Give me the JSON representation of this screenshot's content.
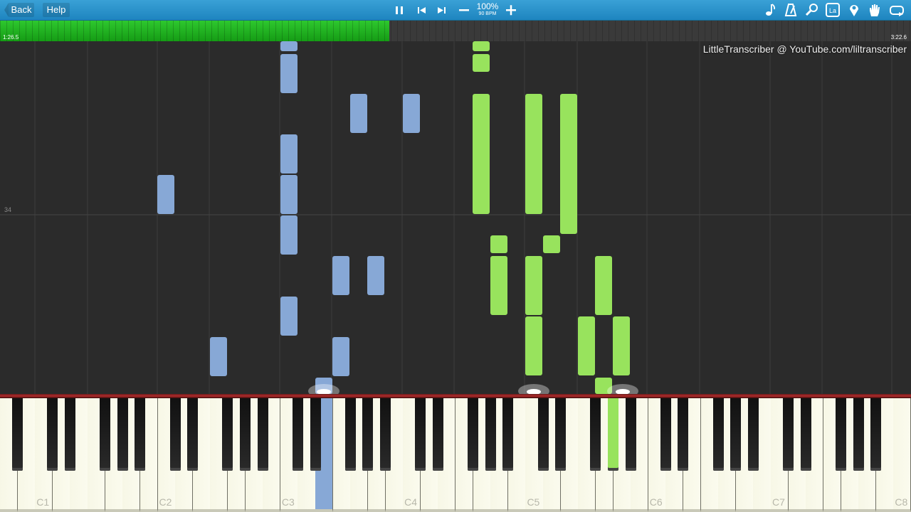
{
  "toolbar": {
    "back_label": "Back",
    "help_label": "Help",
    "tempo_percent": "100%",
    "tempo_bpm": "90 BPM",
    "icons": [
      "pause-icon",
      "previous-icon",
      "next-icon",
      "minus-icon",
      "plus-icon",
      "note-icon",
      "metronome-icon",
      "search-icon",
      "label-icon",
      "marker-icon",
      "hand-icon",
      "loop-icon"
    ]
  },
  "progress": {
    "elapsed": "1:26.5",
    "total": "3:22.6",
    "fraction": 0.427
  },
  "watermark": "LittleTranscriber @ YouTube.com/liltranscriber",
  "measure_number": "34",
  "keyboard": {
    "labels": [
      "C1",
      "C2",
      "C3",
      "C4",
      "C5",
      "C6",
      "C7",
      "C8"
    ],
    "pressed": [
      {
        "note": "E3",
        "hand": "left"
      },
      {
        "note": "G#5",
        "hand": "right"
      }
    ]
  },
  "colors": {
    "left_hand": "#87a8d6",
    "right_hand": "#98e35d",
    "progress": "#22b522",
    "toolbar": "#2a93cc"
  }
}
